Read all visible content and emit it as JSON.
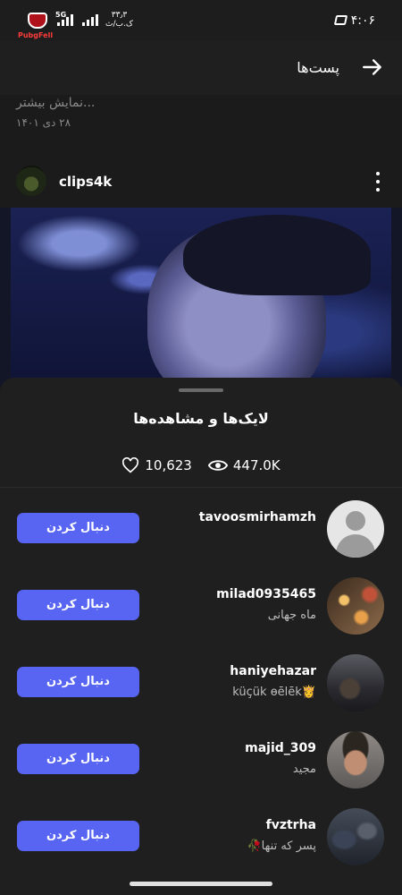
{
  "status_bar": {
    "time": "۴:۰۶",
    "network": "5G",
    "speed_value": "۳۳٫۳",
    "speed_unit": "ک.ب/ث",
    "logo_text": "PubgFell"
  },
  "header": {
    "title": "پست‌ها",
    "back_icon": "arrow-right-icon"
  },
  "post": {
    "show_more": "...نمایش بیشتر",
    "date": "۲۸ دی ۱۴۰۱",
    "author": "clips4k"
  },
  "sheet": {
    "title": "لایک‌ها و مشاهده‌ها",
    "likes": "10,623",
    "views": "447.0K",
    "users": [
      {
        "username": "tavoosmirhamzh",
        "subtitle": "",
        "button": "دنبال کردن",
        "avatar": "default-avatar"
      },
      {
        "username": "milad0935465",
        "subtitle": "ماه جهانی",
        "button": "دنبال کردن",
        "avatar": "candles-photo"
      },
      {
        "username": "haniyehazar",
        "subtitle": "küçük ɵēlēk👸",
        "button": "دنبال کردن",
        "avatar": "street-photo"
      },
      {
        "username": "majid_309",
        "subtitle": "مجید",
        "button": "دنبال کردن",
        "avatar": "man-photo"
      },
      {
        "username": "fvztrha",
        "subtitle": "پسر که تنها🥀",
        "button": "دنبال کردن",
        "avatar": "dark-photo"
      }
    ]
  },
  "colors": {
    "accent": "#5865f2",
    "background": "#1b1b1b",
    "sheet": "#1f1f1f"
  }
}
